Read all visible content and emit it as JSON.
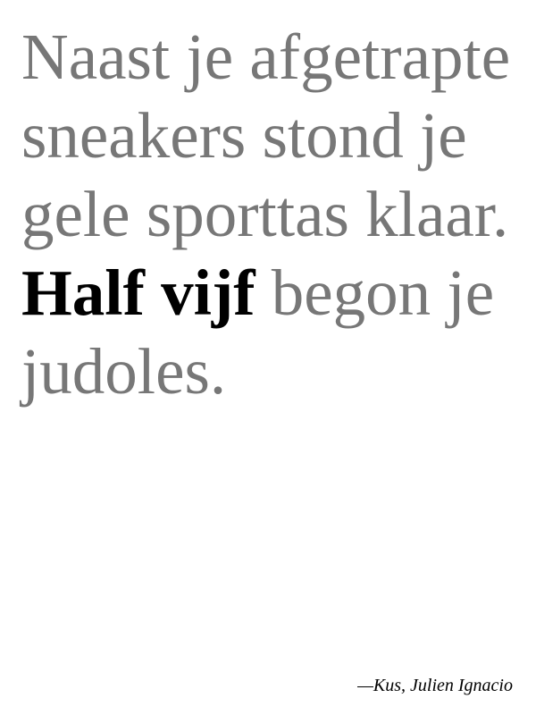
{
  "quote": {
    "before": "Naast je afgetrapte sneakers stond je gele sporttas klaar.",
    "emphasis": "Half vijf",
    "after": "begon je judoles.",
    "text_color": "#777777",
    "emphasis_color": "#000000"
  },
  "attribution": {
    "text": "—Kus, Julien Ignacio"
  }
}
